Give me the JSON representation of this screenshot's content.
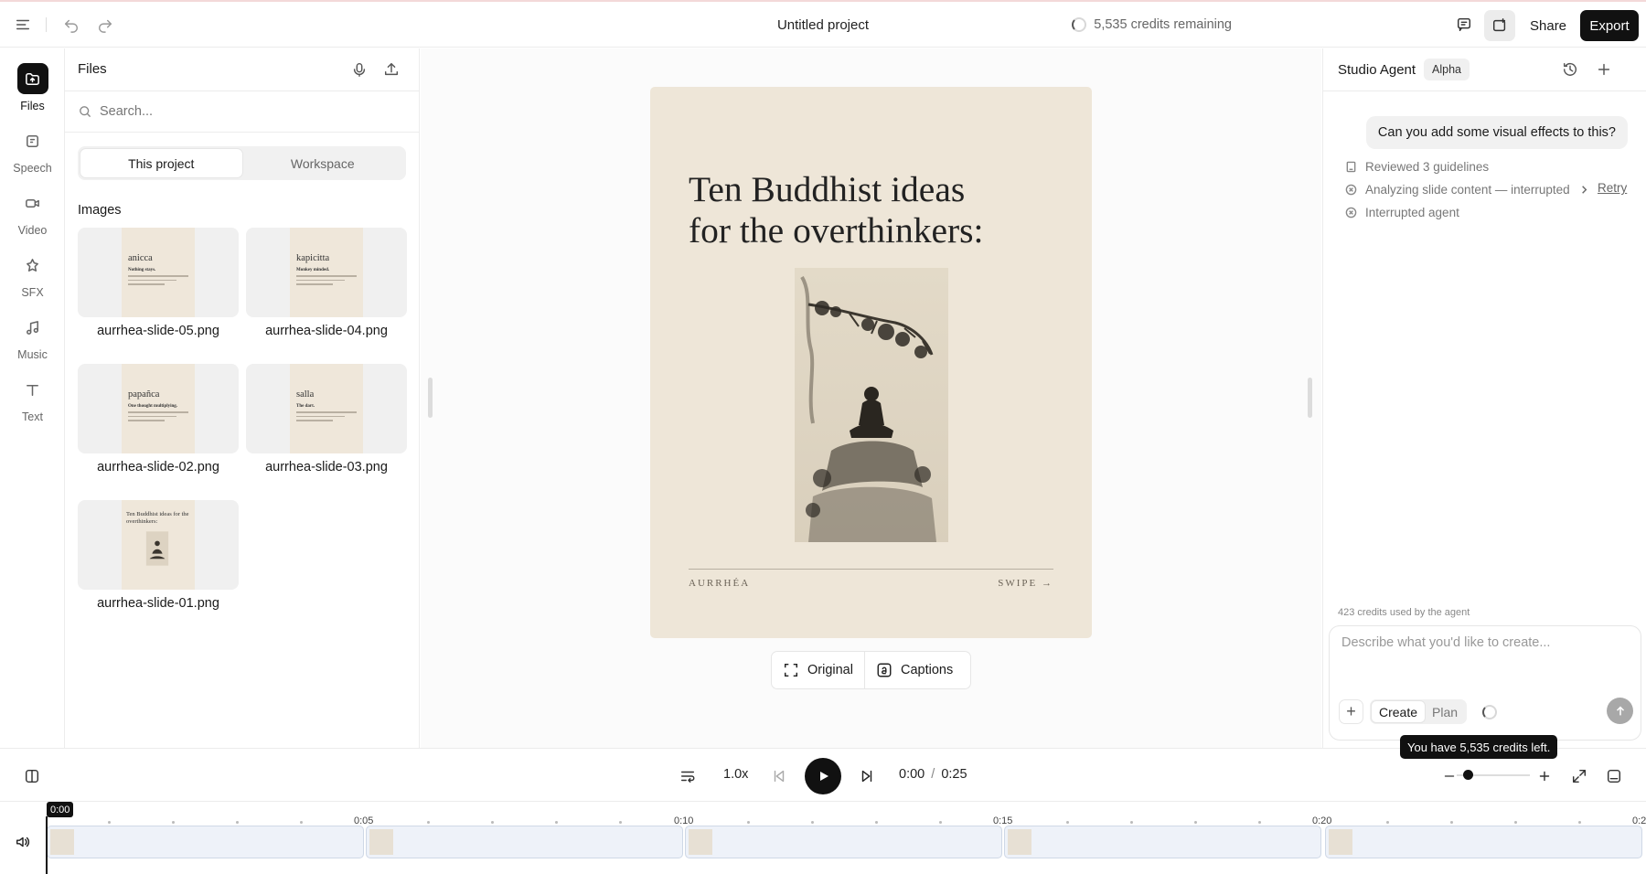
{
  "header": {
    "title": "Untitled project",
    "credits_text": "5,535 credits remaining",
    "share_label": "Share",
    "export_label": "Export"
  },
  "rail": {
    "items": [
      {
        "label": "Files",
        "icon": "folder-upload-icon"
      },
      {
        "label": "Speech",
        "icon": "speech-icon"
      },
      {
        "label": "Video",
        "icon": "video-icon"
      },
      {
        "label": "SFX",
        "icon": "sfx-icon"
      },
      {
        "label": "Music",
        "icon": "music-note-icon"
      },
      {
        "label": "Text",
        "icon": "text-icon"
      }
    ]
  },
  "files": {
    "title": "Files",
    "search_placeholder": "Search...",
    "tabs": [
      "This project",
      "Workspace"
    ],
    "section_title": "Images",
    "images": [
      {
        "name": "aurrhea-slide-05.png",
        "word": "anicca",
        "sub": "Nothing stays."
      },
      {
        "name": "aurrhea-slide-04.png",
        "word": "kapicitta",
        "sub": "Monkey minded."
      },
      {
        "name": "aurrhea-slide-02.png",
        "word": "papañca",
        "sub": "One thought multiplying."
      },
      {
        "name": "aurrhea-slide-03.png",
        "word": "salla",
        "sub": "The dart."
      },
      {
        "name": "aurrhea-slide-01.png",
        "word": "Ten Buddhist ideas for the overthinkers:",
        "sub": ""
      }
    ]
  },
  "canvas": {
    "slide_title_line1": "Ten Buddhist ideas",
    "slide_title_line2": "for the overthinkers:",
    "footer_left": "AURRHÉA",
    "footer_right": "SWIPE →",
    "original_label": "Original",
    "captions_label": "Captions"
  },
  "agent": {
    "title": "Studio Agent",
    "badge": "Alpha",
    "user_message": "Can you add some visual effects to this?",
    "steps": [
      {
        "text": "Reviewed 3 guidelines",
        "icon": "book-icon"
      },
      {
        "text": "Analyzing slide content — interrupted",
        "icon": "x-circle-icon"
      },
      {
        "text": "Interrupted agent",
        "icon": "x-circle-icon"
      }
    ],
    "retry_label": "Retry",
    "credits_used": "423 credits used by the agent",
    "input_placeholder": "Describe what you'd like to create...",
    "modes": [
      "Create",
      "Plan"
    ],
    "tooltip": "You have 5,535 credits left."
  },
  "player": {
    "speed": "1.0x",
    "time_current": "0:00",
    "time_sep": "/",
    "time_total": "0:25",
    "zoom_level": 0.15
  },
  "timeline": {
    "playhead": "0:00",
    "ticks": [
      "0:05",
      "0:10",
      "0:15",
      "0:20",
      "0:2"
    ]
  }
}
